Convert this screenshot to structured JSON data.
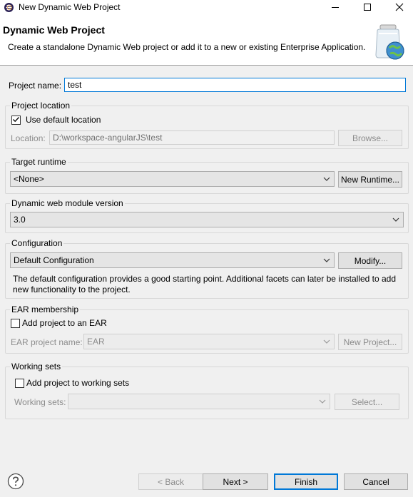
{
  "window": {
    "title": "New Dynamic Web Project",
    "controls": [
      "minimize-icon",
      "maximize-icon",
      "close-icon"
    ]
  },
  "banner": {
    "title": "Dynamic Web Project",
    "description": "Create a standalone Dynamic Web project or add it to a new or existing Enterprise Application.",
    "image_icon": "jar-globe-icon"
  },
  "project_name": {
    "label": "Project name:",
    "value": "test"
  },
  "project_location": {
    "title": "Project location",
    "use_default_label": "Use default location",
    "use_default_checked": true,
    "location_label": "Location:",
    "location_value": "D:\\workspace-angularJS\\test",
    "browse_label": "Browse..."
  },
  "target_runtime": {
    "title": "Target runtime",
    "selected": "<None>",
    "new_runtime_label": "New Runtime..."
  },
  "module_version": {
    "title": "Dynamic web module version",
    "selected": "3.0"
  },
  "configuration": {
    "title": "Configuration",
    "selected": "Default Configuration",
    "modify_label": "Modify...",
    "description": "The default configuration provides a good starting point. Additional facets can later be installed to add new functionality to the project."
  },
  "ear": {
    "title": "EAR membership",
    "add_label": "Add project to an EAR",
    "add_checked": false,
    "name_label": "EAR project name:",
    "name_value": "EAR",
    "new_project_label": "New Project..."
  },
  "working_sets": {
    "title": "Working sets",
    "add_label": "Add project to working sets",
    "add_checked": false,
    "sets_label": "Working sets:",
    "sets_value": "",
    "select_label": "Select..."
  },
  "footer": {
    "help_icon": "help-icon",
    "back_label": "< Back",
    "next_label": "Next >",
    "finish_label": "Finish",
    "cancel_label": "Cancel"
  },
  "colors": {
    "dialog_bg": "#f0f0f0",
    "focus_border": "#0078d7",
    "disabled_text": "#8c8c8c"
  }
}
